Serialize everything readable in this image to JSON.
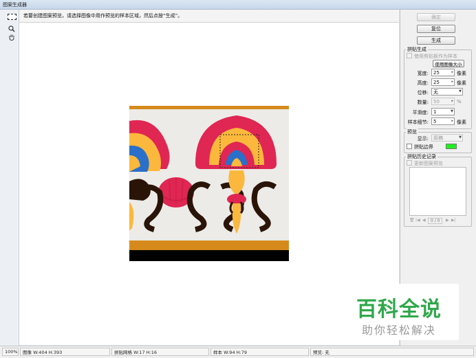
{
  "window": {
    "title": "图案生成器"
  },
  "toolbar": {
    "tools": [
      {
        "name": "rect-select",
        "icon": "marquee-icon"
      },
      {
        "name": "zoom",
        "icon": "magnifier-icon"
      },
      {
        "name": "hand",
        "icon": "hand-icon"
      }
    ]
  },
  "instruction": "若要创建图案预览，请选择图像中用作预览的样本区域，然后点按“生成”。",
  "buttons": {
    "ok": "确定",
    "reset": "复位",
    "generate": "生成"
  },
  "tile_generation": {
    "title": "拼贴生成",
    "use_clipboard_label": "使用剪贴板作为样本",
    "use_image_size_button": "使用图像大小",
    "width_label": "宽度:",
    "width_value": "25",
    "width_unit": "像素",
    "height_label": "高度:",
    "height_value": "25",
    "height_unit": "像素",
    "offset_label": "位移:",
    "offset_value": "无",
    "amount_label": "数量:",
    "amount_value": "50",
    "amount_unit": "%",
    "smoothness_label": "平滑度:",
    "smoothness_value": "1",
    "sample_detail_label": "样本细节:",
    "sample_detail_value": "5",
    "sample_detail_unit": "像素"
  },
  "preview_group": {
    "title": "预览",
    "show_label": "显示:",
    "show_value": "原稿",
    "tile_borders_label": "拼贴边界",
    "tile_border_color": "#22ee22"
  },
  "history_group": {
    "title": "拼贴历史记录",
    "update_pattern_preview_label": "更新图案预览",
    "page_counter": "0 / 0"
  },
  "statusbar": {
    "zoom": "100%",
    "image": "图像 W:404 H:393",
    "tile_grid": "拼贴网格 W:17 H:16",
    "sample": "样本 W:94 H:79",
    "preview": "预览: 无"
  },
  "watermark": {
    "logo": "百科全说",
    "sub": "助你轻松解决"
  },
  "colors": {
    "orange": "#d68a1c",
    "black": "#000000",
    "red": "#e02652",
    "yellow": "#fbb83c",
    "blue": "#2a6fc9",
    "dark": "#2a1408",
    "bg": "#ecebe7",
    "accent_green": "#2fa84a"
  }
}
